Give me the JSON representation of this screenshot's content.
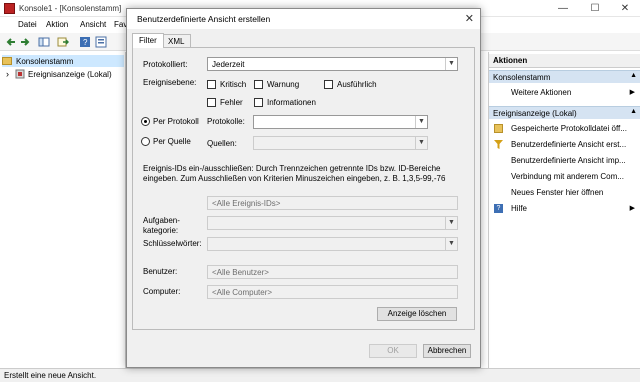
{
  "window": {
    "title": "Konsole1 - [Konsolenstamm]",
    "minimize": "—",
    "maximize": "☐",
    "close": "✕"
  },
  "menu": [
    "Datei",
    "Aktion",
    "Ansicht",
    "Fav"
  ],
  "tree": {
    "root": "Konsolenstamm",
    "child": "Ereignisanzeige (Lokal)",
    "expander": "›"
  },
  "actions": {
    "header": "Aktionen",
    "group1": "Konsolenstamm",
    "group1_items": [
      "Weitere Aktionen"
    ],
    "group2": "Ereignisanzeige (Lokal)",
    "group2_items": [
      "Gespeicherte Protokolldatei öff...",
      "Benutzerdefinierte Ansicht erst...",
      "Benutzerdefinierte Ansicht imp...",
      "Verbindung mit anderem Com...",
      "Neues Fenster hier öffnen",
      "Hilfe"
    ],
    "arrow_up": "▲",
    "arrow_right": "▶"
  },
  "status": "Erstellt eine neue Ansicht.",
  "dialog": {
    "title": "Benutzerdefinierte Ansicht erstellen",
    "close": "✕",
    "tabs": [
      "Filter",
      "XML"
    ],
    "protokolliert_label": "Protokolliert:",
    "protokolliert_value": "Jederzeit",
    "ereignisebene_label": "Ereignisebene:",
    "levels": [
      "Kritisch",
      "Warnung",
      "Ausführlich",
      "Fehler",
      "Informationen"
    ],
    "per_protokoll": "Per Protokoll",
    "per_quelle": "Per Quelle",
    "protokolle_label": "Protokolle:",
    "quellen_label": "Quellen:",
    "description": "Ereignis-IDs ein-/ausschließen: Durch Trennzeichen getrennte IDs bzw. ID-Bereiche eingeben. Zum Ausschließen von Kriterien Minuszeichen eingeben, z. B. 1,3,5-99,-76",
    "event_ids_placeholder": "<Alle Ereignis-IDs>",
    "aufgaben_label": "Aufgaben-\nkategorie:",
    "schluessel_label": "Schlüsselwörter:",
    "benutzer_label": "Benutzer:",
    "benutzer_value": "<Alle Benutzer>",
    "computer_label": "Computer:",
    "computer_value": "<Alle Computer>",
    "clear_button": "Anzeige löschen",
    "ok_button": "OK",
    "cancel_button": "Abbrechen",
    "dropdown_arrow": "▼"
  }
}
